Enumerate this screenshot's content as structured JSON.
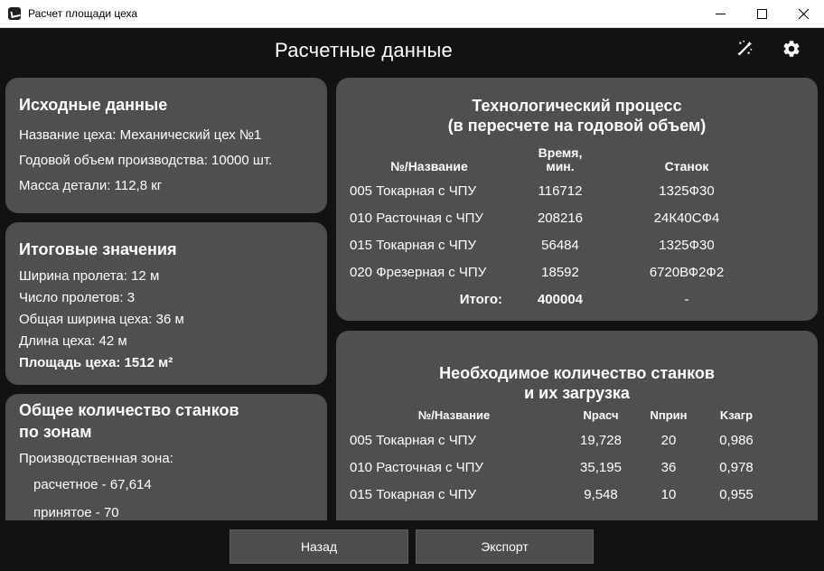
{
  "window": {
    "title": "Расчет площади цеха"
  },
  "header": {
    "title": "Расчетные данные"
  },
  "input": {
    "title": "Исходные данные",
    "rows": [
      "Название цеха: Механический цех №1",
      "Годовой объем производства: 10000 шт.",
      "Масса детали: 112,8 кг"
    ]
  },
  "totals": {
    "title": "Итоговые значения",
    "rows": [
      "Ширина пролета: 12 м",
      "Число пролетов: 3",
      "Общая ширина цеха: 36 м",
      "Длина цеха: 42 м"
    ],
    "area": "Площадь цеха: 1512 м²"
  },
  "machines": {
    "title_line1": "Общее количество станков",
    "title_line2": "по зонам",
    "zone": "Производственная зона:",
    "calc": "расчетное - 67,614",
    "accepted": "принятое - 70"
  },
  "process": {
    "title_line1": "Технологический процесс",
    "title_line2": "(в пересчете на годовой объем)",
    "headers": {
      "name": "№/Название",
      "time_line1": "Время,",
      "time_line2": "мин.",
      "machine": "Станок"
    },
    "rows": [
      {
        "name": "005 Токарная с ЧПУ",
        "time": "116712",
        "machine": "1325Ф30"
      },
      {
        "name": "010 Расточная с ЧПУ",
        "time": "208216",
        "machine": "24К40СФ4"
      },
      {
        "name": "015 Токарная с ЧПУ",
        "time": "56484",
        "machine": "1325Ф30"
      },
      {
        "name": "020 Фрезерная с ЧПУ",
        "time": "18592",
        "machine": "6720ВФ2Ф2"
      }
    ],
    "total": {
      "label": "Итого:",
      "time": "400004",
      "machine": "-"
    }
  },
  "load": {
    "title_line1": "Необходимое количество станков",
    "title_line2": "и их загрузка",
    "headers": {
      "name": "№/Название",
      "n_calc": "Nрасч",
      "n_acc": "Nприн",
      "k": "Kзагр"
    },
    "rows": [
      {
        "name": "005 Токарная с ЧПУ",
        "n_calc": "19,728",
        "n_acc": "20",
        "k": "0,986"
      },
      {
        "name": "010 Расточная с ЧПУ",
        "n_calc": "35,195",
        "n_acc": "36",
        "k": "0,978"
      },
      {
        "name": "015 Токарная с ЧПУ",
        "n_calc": "9,548",
        "n_acc": "10",
        "k": "0,955"
      }
    ]
  },
  "buttons": {
    "back": "Назад",
    "export": "Экспорт"
  }
}
